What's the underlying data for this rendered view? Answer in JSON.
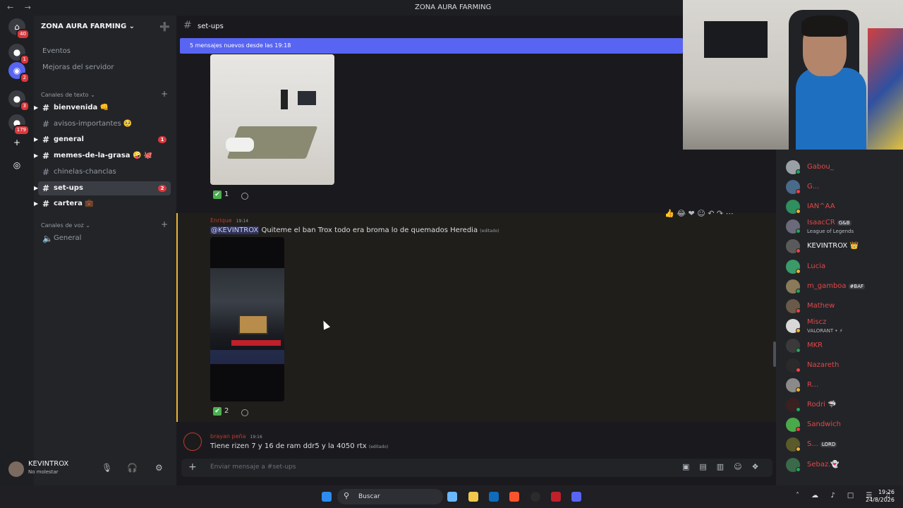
{
  "window": {
    "title": "ZONA AURA FARMING",
    "nav": "← →"
  },
  "servers": [
    {
      "icon": "discord-home-icon",
      "glyph": "⌂",
      "badge": "40"
    },
    {
      "icon": "server-avatar-icon",
      "glyph": "●",
      "badge": "1"
    },
    {
      "icon": "discord-server-icon",
      "glyph": "◉",
      "badge": "2"
    },
    {
      "icon": "server-avatar-icon",
      "glyph": "●",
      "badge": "3"
    },
    {
      "icon": "server-avatar-icon",
      "glyph": "●",
      "badge": "179"
    },
    {
      "icon": "add-server-icon",
      "glyph": "+",
      "badge": ""
    },
    {
      "icon": "discover-icon",
      "glyph": "◎",
      "badge": ""
    }
  ],
  "sidebar": {
    "server_name": "ZONA AURA FARMING ⌄",
    "invite_icon": "➕",
    "events": "Eventos",
    "boosts": "Mejoras del servidor",
    "text_category": "Canales de texto ⌄",
    "voice_category": "Canales de voz ⌄",
    "plus": "+",
    "channels": [
      {
        "name": "bienvenida 👊",
        "unread": true,
        "count": ""
      },
      {
        "name": "avisos-importantes 🥺",
        "unread": false,
        "count": ""
      },
      {
        "name": "general",
        "unread": true,
        "count": "1"
      },
      {
        "name": "memes-de-la-grasa 🤪 🐙",
        "unread": true,
        "count": ""
      },
      {
        "name": "chinelas-chanclas",
        "unread": false,
        "count": ""
      },
      {
        "name": "set-ups",
        "unread": true,
        "count": "2",
        "active": true
      },
      {
        "name": "cartera 💼",
        "unread": true,
        "count": ""
      }
    ],
    "voice_channels": [
      {
        "name": "General"
      }
    ]
  },
  "user": {
    "name": "KEVINTROX",
    "status": "No molestar"
  },
  "channel": {
    "name": "set-ups"
  },
  "new_messages_bar": "5 mensajes nuevos desde las 19:18",
  "messages": [
    {
      "reactions": [
        {
          "emoji": "✔",
          "count": "1"
        }
      ]
    },
    {
      "author": "Enrique",
      "time": "19:14",
      "mention": "@KEVINTROX",
      "text": " Quiteme el ban Trox todo era broma lo de quemados Heredia",
      "edited": "(editado)",
      "reactions": [
        {
          "emoji": "✔",
          "count": "2"
        }
      ]
    },
    {
      "author": "brayan peña",
      "time": "19:16",
      "text": "Tiene rizen 7 y 16 de ram ddr5 y la 4050 rtx",
      "edited": "(editado)"
    }
  ],
  "hover_toolbar": "👍 😂 ❤ ☺ ↶ ↷ ⋯",
  "composer": {
    "placeholder": "Enviar mensaje a #set-ups",
    "plus": "+",
    "tools": "▣▤▥☺❖"
  },
  "members": [
    {
      "name": "Gabou_",
      "color": "#e04848",
      "sub": "",
      "tag": ""
    },
    {
      "name": "G...",
      "color": "#e04848",
      "sub": "",
      "tag": ""
    },
    {
      "name": "IAN^AA",
      "color": "#e04848",
      "sub": "",
      "tag": ""
    },
    {
      "name": "IsaacCR",
      "color": "#e04848",
      "sub": "League of Legends",
      "tag": "G&B"
    },
    {
      "name": "KEVINTROX 👑",
      "color": "#f2f3f5",
      "sub": "",
      "tag": ""
    },
    {
      "name": "Lucia",
      "color": "#e04848",
      "sub": "",
      "tag": ""
    },
    {
      "name": "m_gamboa",
      "color": "#e04848",
      "sub": "",
      "tag": "#BAF"
    },
    {
      "name": "Mathew",
      "color": "#e04848",
      "sub": "",
      "tag": ""
    },
    {
      "name": "Miscz",
      "color": "#e04848",
      "sub": "VALORANT • ⚡",
      "tag": ""
    },
    {
      "name": "MKR",
      "color": "#e04848",
      "sub": "",
      "tag": ""
    },
    {
      "name": "Nazareth",
      "color": "#e04848",
      "sub": "",
      "tag": ""
    },
    {
      "name": "R...",
      "color": "#e04848",
      "sub": "",
      "tag": ""
    },
    {
      "name": "Rodri 🦈",
      "color": "#e04848",
      "sub": "",
      "tag": ""
    },
    {
      "name": "Sandwich",
      "color": "#e04848",
      "sub": "",
      "tag": ""
    },
    {
      "name": "S...",
      "color": "#e04848",
      "sub": "",
      "tag": "LORD"
    },
    {
      "name": "Sebaz.👻",
      "color": "#e04848",
      "sub": "",
      "tag": ""
    }
  ],
  "taskbar": {
    "search": "Buscar",
    "time": "19:26",
    "date": "24/8/2026",
    "tray": "˄ ☁ ♪ □ ☰ ♫"
  }
}
